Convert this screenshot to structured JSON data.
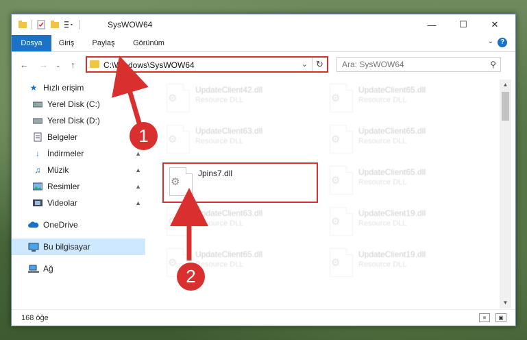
{
  "window": {
    "title": "SysWOW64",
    "controls": {
      "minimize": "—",
      "maximize": "☐",
      "close": "✕"
    }
  },
  "ribbon": {
    "tabs": [
      "Dosya",
      "Giriş",
      "Paylaş",
      "Görünüm"
    ],
    "help": "?"
  },
  "address": {
    "path": "C:\\Windows\\SysWOW64",
    "search_placeholder": "Ara: SysWOW64"
  },
  "sidebar": {
    "items": [
      {
        "label": "Hızlı erişim",
        "icon": "star-icon"
      },
      {
        "label": "Yerel Disk (C:)",
        "icon": "drive-icon"
      },
      {
        "label": "Yerel Disk (D:)",
        "icon": "drive-icon"
      },
      {
        "label": "Belgeler",
        "icon": "documents-icon"
      },
      {
        "label": "İndirmeler",
        "icon": "downloads-icon"
      },
      {
        "label": "Müzik",
        "icon": "music-icon"
      },
      {
        "label": "Resimler",
        "icon": "pictures-icon"
      },
      {
        "label": "Videolar",
        "icon": "videos-icon"
      },
      {
        "label": "OneDrive",
        "icon": "cloud-icon"
      },
      {
        "label": "Bu bilgisayar",
        "icon": "computer-icon"
      },
      {
        "label": "Ağ",
        "icon": "network-icon"
      }
    ]
  },
  "files": [
    {
      "name": "UpdateClient42.dll",
      "type": "Resource DLL"
    },
    {
      "name": "UpdateClient65.dll",
      "type": "Resource DLL"
    },
    {
      "name": "UpdateClient63.dll",
      "type": "Resource DLL"
    },
    {
      "name": "UpdateClient65.dll",
      "type": "Resource DLL"
    },
    {
      "name": "Jpins7.dll",
      "type": ""
    },
    {
      "name": "UpdateClient65.dll",
      "type": "Resource DLL"
    },
    {
      "name": "UpdateClient63.dll",
      "type": "Resource DLL"
    },
    {
      "name": "UpdateClient19.dll",
      "type": "Resource DLL"
    },
    {
      "name": "UpdateClient65.dll",
      "type": "Resource DLL"
    },
    {
      "name": "UpdateClient19.dll",
      "type": "Resource DLL"
    }
  ],
  "status": {
    "item_count": "168 öğe"
  },
  "callouts": [
    "1",
    "2"
  ],
  "colors": {
    "highlight": "#d9302f",
    "accent": "#1a73c6",
    "selection": "#cde8ff"
  }
}
